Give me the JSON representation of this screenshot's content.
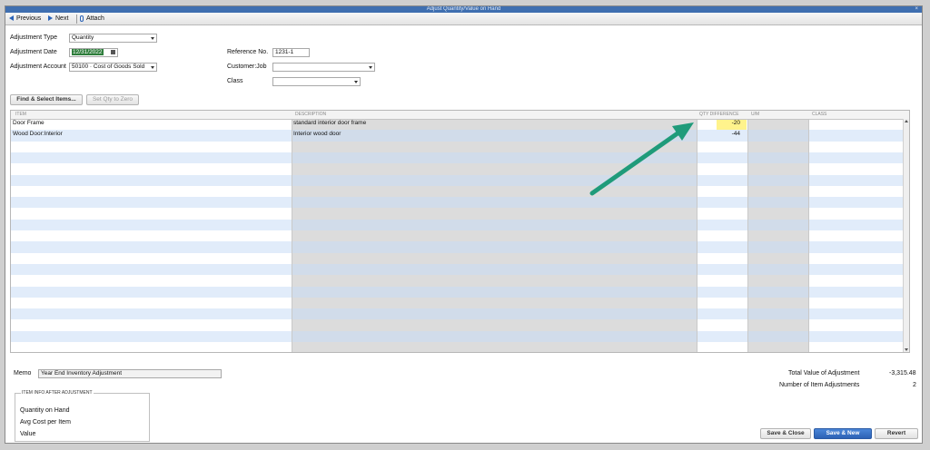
{
  "window": {
    "title": "Adjust Quantity/Value on Hand",
    "close_glyph": "×"
  },
  "toolbar": {
    "previous": {
      "label": "Previous",
      "icon": "left-arrow-icon"
    },
    "next": {
      "label": "Next",
      "icon": "right-arrow-icon"
    },
    "attach": {
      "label": "Attach",
      "icon": "paperclip-icon"
    }
  },
  "form": {
    "adjustment_type": {
      "label": "Adjustment Type",
      "value": "Quantity"
    },
    "adjustment_date": {
      "label": "Adjustment Date",
      "value": "12/31/2022"
    },
    "adjustment_account": {
      "label": "Adjustment Account",
      "value": "50100 · Cost of Goods Sold"
    },
    "reference_no": {
      "label": "Reference No.",
      "value": "1231-1"
    },
    "customer_job": {
      "label": "Customer:Job",
      "value": ""
    },
    "class": {
      "label": "Class",
      "value": ""
    }
  },
  "buttons": {
    "find_select": "Find & Select Items...",
    "set_qty_zero": "Set Qty to Zero",
    "save_close": "Save & Close",
    "save_new": "Save & New",
    "revert": "Revert"
  },
  "grid": {
    "columns": [
      "ITEM",
      "DESCRIPTION",
      "QTY DIFFERENCE",
      "U/M",
      "CLASS"
    ],
    "rows": [
      {
        "item": "Door Frame",
        "description": "standard interior door frame",
        "qty": "-20",
        "um": "",
        "class": ""
      },
      {
        "item": "Wood Door:Interior",
        "description": "Interior wood door",
        "qty": "-44",
        "um": "",
        "class": ""
      }
    ]
  },
  "memo": {
    "label": "Memo",
    "value": "Year End Inventory Adjustment"
  },
  "item_info": {
    "title": "ITEM INFO AFTER ADJUSTMENT",
    "quantity_on_hand": "Quantity on Hand",
    "avg_cost": "Avg Cost per Item",
    "value": "Value"
  },
  "totals": {
    "total_value_label": "Total Value of Adjustment",
    "total_value": "-3,315.48",
    "num_adjustments_label": "Number of Item Adjustments",
    "num_adjustments": "2"
  },
  "colors": {
    "highlight": "#fff38c",
    "arrow": "#1f9b7a",
    "accent": "#2d62b5"
  }
}
